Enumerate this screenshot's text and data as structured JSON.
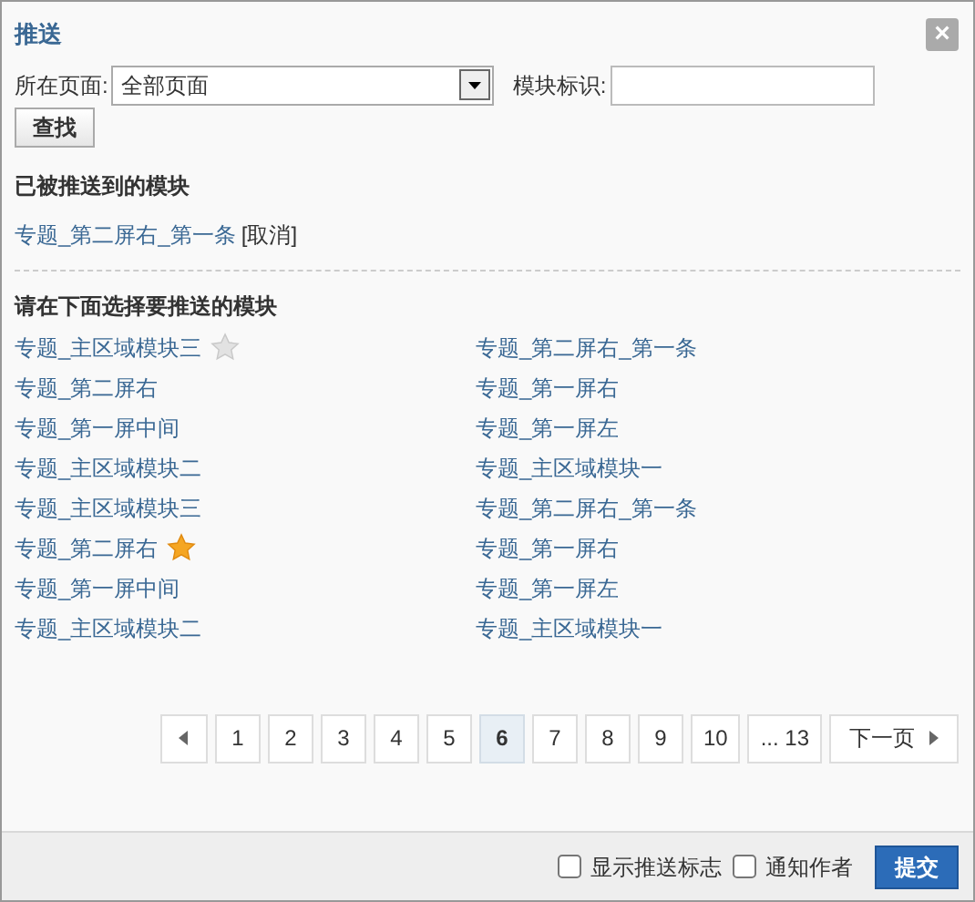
{
  "dialog": {
    "title": "推送",
    "close": "×"
  },
  "filters": {
    "page_label": "所在页面:",
    "page_value": "全部页面",
    "module_label": "模块标识:",
    "search_button": "查找"
  },
  "pushed": {
    "heading": "已被推送到的模块",
    "items": [
      {
        "name": "专题_第二屏右_第一条",
        "action": "[取消]"
      }
    ]
  },
  "choose": {
    "heading": "请在下面选择要推送的模块",
    "items": [
      {
        "name": "专题_主区域模块三",
        "kind": "star-off"
      },
      {
        "name": "专题_第二屏右_第一条",
        "kind": "plain"
      },
      {
        "name": "专题_第二屏右",
        "kind": "plain"
      },
      {
        "name": "专题_第一屏右",
        "kind": "plain"
      },
      {
        "name": "专题_第一屏中间",
        "kind": "plain"
      },
      {
        "name": "专题_第一屏左",
        "kind": "plain"
      },
      {
        "name": "专题_主区域模块二",
        "kind": "plain"
      },
      {
        "name": "专题_主区域模块一",
        "kind": "plain"
      },
      {
        "name": "专题_主区域模块三",
        "kind": "plain"
      },
      {
        "name": "专题_第二屏右_第一条",
        "kind": "plain"
      },
      {
        "name": "专题_第二屏右",
        "kind": "star-on"
      },
      {
        "name": "专题_第一屏右",
        "kind": "plain"
      },
      {
        "name": "专题_第一屏中间",
        "kind": "plain"
      },
      {
        "name": "专题_第一屏左",
        "kind": "plain"
      },
      {
        "name": "专题_主区域模块二",
        "kind": "plain"
      },
      {
        "name": "专题_主区域模块一",
        "kind": "plain"
      }
    ]
  },
  "pagination": {
    "pages": [
      {
        "label": "1",
        "selected": false
      },
      {
        "label": "2",
        "selected": false
      },
      {
        "label": "3",
        "selected": false
      },
      {
        "label": "4",
        "selected": false
      },
      {
        "label": "5",
        "selected": false
      },
      {
        "label": "6",
        "selected": true
      },
      {
        "label": "7",
        "selected": false
      },
      {
        "label": "8",
        "selected": false
      },
      {
        "label": "9",
        "selected": false
      },
      {
        "label": "10",
        "selected": false
      },
      {
        "label": "... 13",
        "selected": false
      }
    ],
    "next": "下一页"
  },
  "footer": {
    "options": [
      {
        "label": "显示推送标志",
        "checked": false
      },
      {
        "label": "通知作者",
        "checked": false
      }
    ],
    "submit": "提交"
  }
}
